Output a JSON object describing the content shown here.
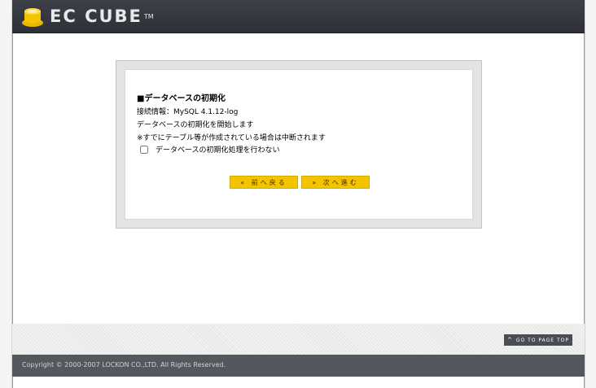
{
  "header": {
    "logo_text": "EC CUBE",
    "logo_tm": "TM"
  },
  "panel": {
    "title": "■データベースの初期化",
    "connection_info": "接続情報：MySQL 4.1.12-log",
    "message1": "データベースの初期化を開始します",
    "message2": "※すでにテーブル等が作成されている場合は中断されます",
    "checkbox_label": "データベースの初期化処理を行わない",
    "checkbox_checked": false
  },
  "buttons": {
    "back_label": "« 前へ戻る",
    "next_label": "» 次へ進む"
  },
  "footer": {
    "page_top_label": "GO TO PAGE TOP",
    "page_top_arrow": "^",
    "copyright": "Copyright © 2000-2007 LOCKON CO.,LTD. All Rights Reserved."
  },
  "colors": {
    "header_bg": "#35373f",
    "button_yellow": "#f5c400",
    "footer_bg": "#55575e"
  }
}
